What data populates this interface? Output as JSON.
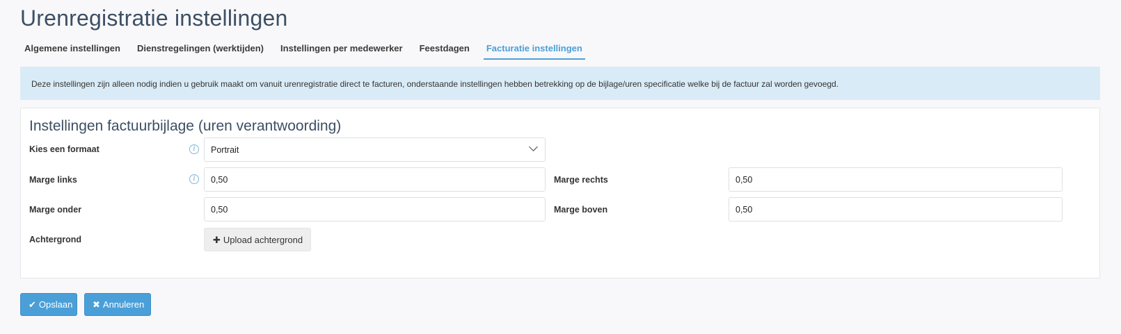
{
  "page": {
    "title": "Urenregistratie instellingen"
  },
  "tabs": [
    {
      "label": "Algemene instellingen"
    },
    {
      "label": "Dienstregelingen (werktijden)"
    },
    {
      "label": "Instellingen per medewerker"
    },
    {
      "label": "Feestdagen"
    },
    {
      "label": "Facturatie instellingen",
      "active": true
    }
  ],
  "banner": {
    "text": "Deze instellingen zijn alleen nodig indien u gebruik maakt om vanuit urenregistratie direct te facturen, onderstaande instellingen hebben betrekking op de bijlage/uren specificatie welke bij de factuur zal worden gevoegd."
  },
  "panel": {
    "title": "Instellingen factuurbijlage (uren verantwoording)",
    "format": {
      "label": "Kies een formaat",
      "value": "Portrait"
    },
    "marge_links": {
      "label": "Marge links",
      "value": "0,50"
    },
    "marge_rechts": {
      "label": "Marge rechts",
      "value": "0,50"
    },
    "marge_onder": {
      "label": "Marge onder",
      "value": "0,50"
    },
    "marge_boven": {
      "label": "Marge boven",
      "value": "0,50"
    },
    "achtergrond": {
      "label": "Achtergrond",
      "button": "Upload achtergrond"
    }
  },
  "actions": {
    "save": "Opslaan",
    "cancel": "Annuleren"
  },
  "colors": {
    "accent": "#4a9fd8",
    "banner": "#d9ebf6",
    "title": "#3d4f63"
  }
}
